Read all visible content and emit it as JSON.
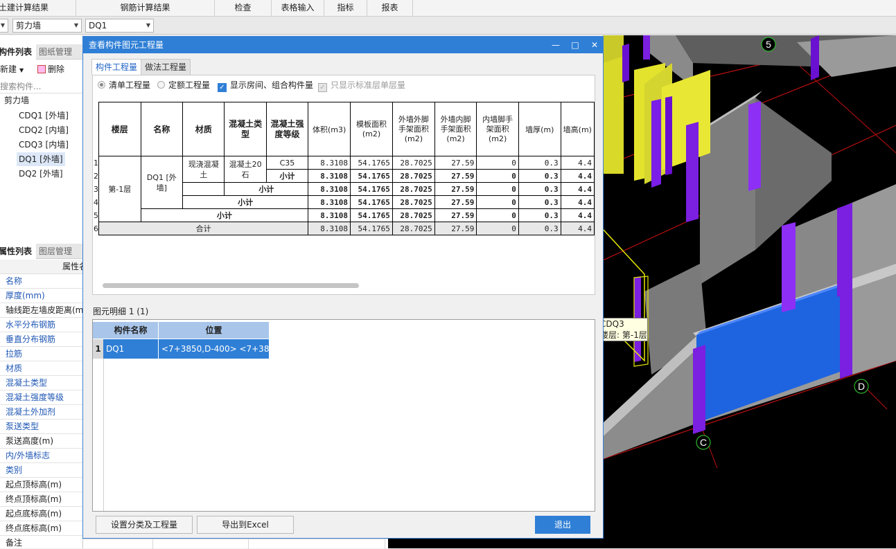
{
  "menu": {
    "items": [
      "土建计算结果",
      "钢筋计算结果",
      "检查",
      "表格输入",
      "指标",
      "报表"
    ]
  },
  "toolbar": {
    "combo_type": "剪力墙",
    "combo_member": "DQ1"
  },
  "left_panel": {
    "tabs": [
      "构件列表",
      "图纸管理"
    ],
    "new_label": "新建",
    "delete_label": "删除",
    "search_placeholder": "搜索构件...",
    "tree_root": "剪力墙",
    "tree_items": [
      "CDQ1 [外墙]",
      "CDQ2 [内墙]",
      "CDQ3 [内墙]",
      "DQ1 [外墙]",
      "DQ2 [外墙]"
    ],
    "prop_tabs": [
      "属性列表",
      "图层管理"
    ],
    "prop_header": "属性名",
    "props": [
      {
        "label": "名称",
        "blue": true
      },
      {
        "label": "厚度(mm)",
        "blue": true
      },
      {
        "label": "轴线距左墙皮距离(mm)",
        "blue": false
      },
      {
        "label": "水平分布钢筋",
        "blue": true
      },
      {
        "label": "垂直分布钢筋",
        "blue": true
      },
      {
        "label": "拉筋",
        "blue": true
      },
      {
        "label": "材质",
        "blue": true
      },
      {
        "label": "混凝土类型",
        "blue": true
      },
      {
        "label": "混凝土强度等级",
        "blue": true
      },
      {
        "label": "混凝土外加剂",
        "blue": true
      },
      {
        "label": "泵送类型",
        "blue": true
      },
      {
        "label": "泵送高度(m)",
        "blue": false
      },
      {
        "label": "内/外墙标志",
        "blue": true
      },
      {
        "label": "类别",
        "blue": true
      },
      {
        "label": "起点顶标高(m)",
        "blue": false
      },
      {
        "label": "终点顶标高(m)",
        "blue": false
      },
      {
        "label": "起点底标高(m)",
        "blue": false
      },
      {
        "label": "终点底标高(m)",
        "blue": false
      },
      {
        "label": "备注",
        "blue": false
      }
    ]
  },
  "dialog": {
    "title": "查看构件图元工程量",
    "tabs": [
      "构件工程量",
      "做法工程量"
    ],
    "options": {
      "opt1": "清单工程量",
      "opt2": "定额工程量",
      "opt3": "显示房间、组合构件量",
      "opt4": "只显示标准层单层量"
    },
    "table": {
      "headers": [
        "楼层",
        "名称",
        "材质",
        "混凝土类型",
        "混凝土强度等级",
        "体积(m3)",
        "模板面积(m2)",
        "外墙外脚手架面积(m2)",
        "外墙内脚手架面积(m2)",
        "内墙脚手架面积(m2)",
        "墙厚(m)",
        "墙高(m)"
      ],
      "row_numbers": [
        "1",
        "2",
        "3",
        "4",
        "5",
        "6"
      ],
      "floor": "第-1层",
      "name": "DQ1 [外墙]",
      "material": "现浇混凝土",
      "concrete_type": "混凝土20石",
      "grade": "C35",
      "subtotal": "小计",
      "total": "合计",
      "values": [
        "8.3108",
        "54.1765",
        "28.7025",
        "27.59",
        "0",
        "0.3",
        "4.4"
      ]
    },
    "detail_label": "图元明细  1 (1)",
    "detail_headers": [
      "构件名称",
      "位置"
    ],
    "detail_row": {
      "index": "1",
      "name": "DQ1",
      "position": "<7+3850,D-400> <7+38..."
    },
    "buttons": {
      "set_category": "设置分类及工程量",
      "export": "导出到Excel",
      "exit": "退出"
    }
  },
  "view3d": {
    "axis_labels": [
      "5",
      "D",
      "C"
    ],
    "tooltip_name": "CDQ3",
    "tooltip_floor": "楼层: 第-1层"
  }
}
